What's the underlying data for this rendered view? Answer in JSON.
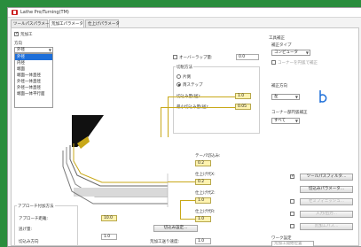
{
  "window": {
    "title": "Lathe Pro/Turning(TM)"
  },
  "tabs": [
    {
      "label": "ツールパスパラメータ"
    },
    {
      "label": "荒加工パラメータ"
    },
    {
      "label": "仕上げパラメータ"
    }
  ],
  "left": {
    "enable_label": "荒加工",
    "direction_label": "方向",
    "direction_selected": "外径",
    "direction_options": [
      "外径",
      "内径",
      "端面",
      "端面一体直径",
      "外径一体直径",
      "外径一体直径",
      "端面一体平行面"
    ],
    "overlap_label": "オーバーラップ量:",
    "overlap_value": "0.0",
    "cut_method_group": "切削方法",
    "cut_method_options": [
      "片側",
      "両ステップ"
    ],
    "pitch_label": "切込み量(径):",
    "pitch_value": "1.0",
    "min_pitch_label": "最小切込み量(径):",
    "min_pitch_value": "0.05",
    "tool_allow_label": "テーパ切込み:",
    "tool_allow_value": "0.2",
    "stock_x_label": "仕上げ代X:",
    "stock_x_value": "0.2",
    "stock_z_label": "仕上げ代Z:",
    "stock_z_value": "1.0",
    "stock_r_label": "仕上げ代R:",
    "stock_r_value": "1.0",
    "approach_group": "アプローチ付加方法",
    "approach_dist_label": "アプローチ距離:",
    "approach_dist_value": "10.0",
    "retract_label": "逃げ量:",
    "retract_value": "1.0",
    "cycle_label": "切込み方向",
    "plunge_button": "切込み設定...",
    "rough_speed_label": "荒加工送り速度:",
    "rough_speed_value": "1.0"
  },
  "right": {
    "group_title": "工具補正",
    "comp_type_label": "補正タイプ",
    "comp_type_value": "コンピュータ",
    "corner_label": "コーナーを円弧で補正",
    "comp_dir_label": "補正方向",
    "comp_dir_value": "左",
    "corner_break_label": "コーナー部円弧補正",
    "corner_break_value": "すべて",
    "btn_toolpath": "ツールパスフィルタ...",
    "btn_plunge_param": "切込みパラメータ...",
    "btn_3": "セミフィニッシュ...",
    "btn_4": "入力/出力...",
    "btn_5": "荒加工パス...",
    "bottom_label": "ワーク設定",
    "bottom_value": "荒加工開始位置"
  },
  "colors": {
    "accent": "#c8a818",
    "select": "#1e6fd9",
    "background": "#2a8d3d"
  }
}
